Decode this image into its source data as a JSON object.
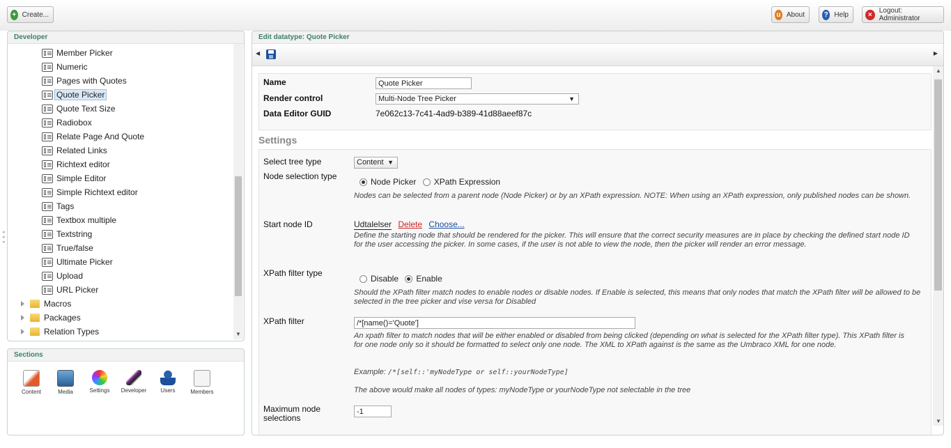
{
  "toolbar": {
    "create_label": "Create...",
    "about_label": "About",
    "help_label": "Help",
    "logout_label": "Logout: Administrator"
  },
  "developer_panel": {
    "title": "Developer",
    "datatypes": [
      "Member Picker",
      "Numeric",
      "Pages with Quotes",
      "Quote Picker",
      "Quote Text Size",
      "Radiobox",
      "Relate Page And Quote",
      "Related Links",
      "Richtext editor",
      "Simple Editor",
      "Simple Richtext editor",
      "Tags",
      "Textbox multiple",
      "Textstring",
      "True/false",
      "Ultimate Picker",
      "Upload",
      "URL Picker"
    ],
    "selected": "Quote Picker",
    "folders": [
      "Macros",
      "Packages",
      "Relation Types"
    ]
  },
  "sections_panel": {
    "title": "Sections",
    "items": [
      "Content",
      "Media",
      "Settings",
      "Developer",
      "Users",
      "Members"
    ]
  },
  "editor": {
    "title": "Edit datatype: Quote Picker",
    "name_label": "Name",
    "name_value": "Quote Picker",
    "render_label": "Render control",
    "render_value": "Multi-Node Tree Picker",
    "guid_label": "Data Editor GUID",
    "guid_value": "7e062c13-7c41-4ad9-b389-41d88aeef87c",
    "settings_heading": "Settings",
    "tree_type_label": "Select tree type",
    "tree_type_value": "Content",
    "node_sel_label": "Node selection type",
    "node_picker_label": "Node Picker",
    "xpath_expr_label": "XPath Expression",
    "node_sel_desc": "Nodes can be selected from a parent node (Node Picker) or by an XPath expression. NOTE: When using an XPath expression, only published nodes can be shown.",
    "start_node_label": "Start node ID",
    "start_node_value": "Udtalelser",
    "delete_label": "Delete",
    "choose_label": "Choose...",
    "start_node_desc": "Define the starting node that should be rendered for the picker. This will ensure that the correct security measures are in place by checking the defined start node ID for the user accessing the picker. In some cases, if the user is not able to view the node, then the picker will render an error message.",
    "xpath_filter_type_label": "XPath filter type",
    "disable_label": "Disable",
    "enable_label": "Enable",
    "xpath_filter_type_desc": "Should the XPath filter match nodes to enable nodes or disable nodes. If Enable is selected, this means that only nodes that match the XPath filter will be allowed to be selected in the tree picker and vise versa for Disabled",
    "xpath_filter_label": "XPath filter",
    "xpath_filter_value": "/*[name()='Quote']",
    "xpath_filter_desc": "An xpath filter to match nodes that will be either enabled or disabled from being clicked (depending on what is selected for the XPath filter type). This XPath filter is for one node only so it should be formatted to select only one node. The XML to XPath against is the same as the Umbraco XML for one node.",
    "example_prefix": "Example: ",
    "example_code": "/*[self::'myNodeType or self::yourNodeType]",
    "example_result": "The above would make all nodes of types: myNodeType or yourNodeType not selectable in the tree",
    "max_sel_label": "Maximum node selections",
    "max_sel_value": "-1"
  },
  "colors": {
    "accent": "#3d7f6c",
    "link": "#1a4fa0",
    "delete": "#cc2222"
  },
  "icons": [
    "create-plus-icon",
    "about-icon",
    "help-icon",
    "logout-icon",
    "save-icon",
    "datatype-icon",
    "folder-icon"
  ]
}
